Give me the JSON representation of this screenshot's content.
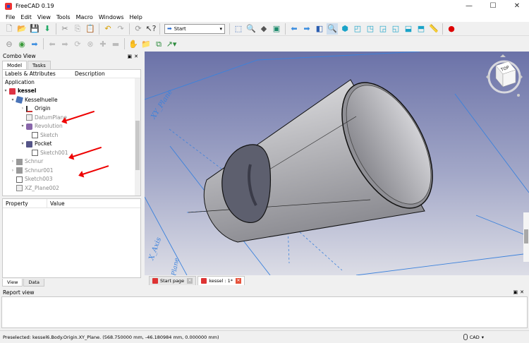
{
  "window": {
    "title": "FreeCAD 0.19",
    "minimize": "—",
    "maximize": "☐",
    "close": "✕"
  },
  "menu": [
    "File",
    "Edit",
    "View",
    "Tools",
    "Macro",
    "Windows",
    "Help"
  ],
  "toolbar": {
    "workbench": "Start"
  },
  "combo_view": {
    "title": "Combo View",
    "tabs": [
      "Model",
      "Tasks"
    ],
    "tree_headers": {
      "labels": "Labels & Attributes",
      "description": "Description"
    },
    "section": "Application",
    "tree": [
      {
        "label": "kessel",
        "icon": "document-icon",
        "bold": true
      },
      {
        "label": "Kesselhuelle",
        "icon": "body-icon"
      },
      {
        "label": "Origin",
        "icon": "origin-icon"
      },
      {
        "label": "DatumPlane",
        "icon": "datum-plane-icon"
      },
      {
        "label": "Revolution",
        "icon": "revolution-icon"
      },
      {
        "label": "Sketch",
        "icon": "sketch-icon"
      },
      {
        "label": "Pocket",
        "icon": "pocket-icon"
      },
      {
        "label": "Sketch001",
        "icon": "sketch-icon"
      },
      {
        "label": "Schnur",
        "icon": "body-icon"
      },
      {
        "label": "Schnur001",
        "icon": "body-icon"
      },
      {
        "label": "Sketch003",
        "icon": "sketch-icon"
      },
      {
        "label": "XZ_Plane002",
        "icon": "plane-icon"
      }
    ],
    "prop_headers": {
      "property": "Property",
      "value": "Value"
    },
    "bottom_tabs": [
      "View",
      "Data"
    ]
  },
  "viewport": {
    "labels": {
      "xy_plane": "XY_Plane",
      "x_axis": "X_Axis",
      "plane_bottom": "Plane"
    },
    "navcube": {
      "face": "TOP"
    }
  },
  "doc_tabs": [
    {
      "label": "Start page"
    },
    {
      "label": "kessel : 1*"
    }
  ],
  "report": {
    "title": "Report view"
  },
  "status": {
    "text": "Preselected: kessel6.Body.Origin.XY_Plane. (568.750000 mm, -46.180984 mm, 0.000000 mm)",
    "nav_style": "CAD"
  },
  "colors": {
    "viewport_top": "#6b72a8",
    "viewport_bottom": "#dcdde6",
    "annotation_arrow": "#e00000",
    "plane_lines": "#3c82dc"
  }
}
